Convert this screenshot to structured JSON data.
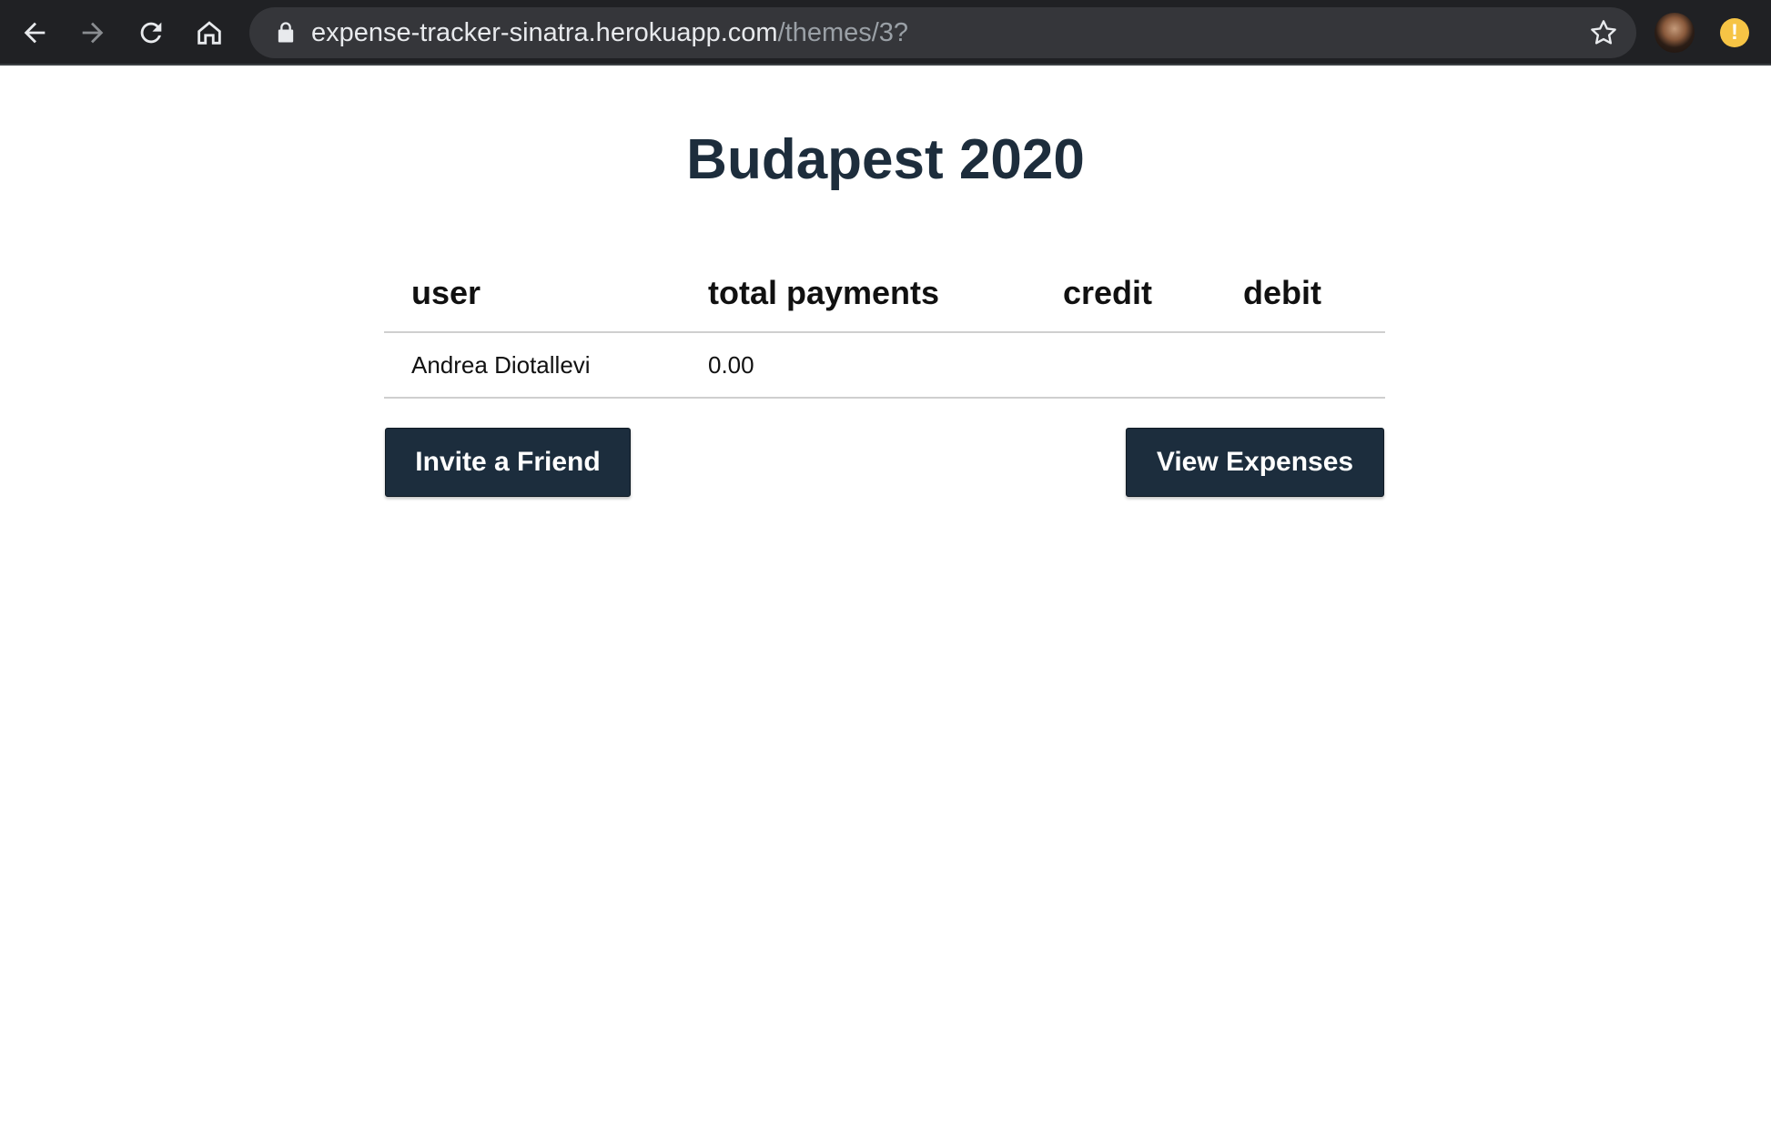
{
  "browser": {
    "url_host": "expense-tracker-sinatra.herokuapp.com",
    "url_path": "/themes/3?"
  },
  "page": {
    "title": "Budapest 2020"
  },
  "table": {
    "headers": [
      "user",
      "total payments",
      "credit",
      "debit"
    ],
    "rows": [
      {
        "user": "Andrea Diotallevi",
        "total_payments": "0.00",
        "credit": "",
        "debit": ""
      }
    ]
  },
  "actions": {
    "invite_label": "Invite a Friend",
    "view_expenses_label": "View Expenses"
  },
  "icons": {
    "back": "back-arrow-icon",
    "forward": "forward-arrow-icon",
    "reload": "reload-icon",
    "home": "home-icon",
    "lock": "lock-icon",
    "star": "star-icon",
    "alert": "alert-icon"
  },
  "colors": {
    "toolbar_bg": "#202124",
    "omnibox_bg": "#35363a",
    "title": "#1d2d3c",
    "button_bg": "#1c2d3d",
    "alert_badge": "#f6c445"
  }
}
